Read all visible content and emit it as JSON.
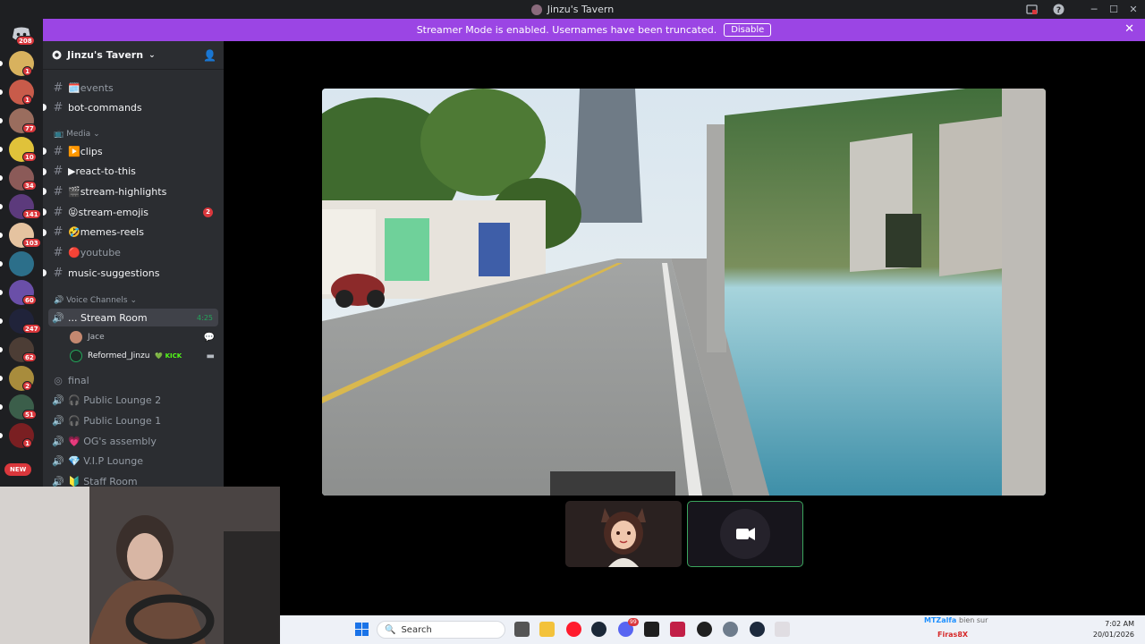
{
  "window": {
    "title": "Jinzu's Tavern"
  },
  "banner": {
    "text": "Streamer Mode is enabled. Usernames have been truncated.",
    "button": "Disable"
  },
  "rail": {
    "home_badge": "208",
    "servers": [
      {
        "badge": "1",
        "color": "#d8b25e"
      },
      {
        "badge": "1",
        "color": "#c85b4a"
      },
      {
        "badge": "77",
        "color": "#9a6d5e"
      },
      {
        "badge": "10",
        "color": "#e0c23a"
      },
      {
        "badge": "34",
        "color": "#8b5a58"
      },
      {
        "badge": "141",
        "color": "#5c3a7c"
      },
      {
        "badge": "103",
        "color": "#e5c3a0"
      },
      {
        "badge": "",
        "color": "#2c6f8a"
      },
      {
        "badge": "60",
        "color": "#6a4fa8"
      },
      {
        "badge": "247",
        "color": "#20233a"
      },
      {
        "badge": "62",
        "color": "#4c3d35"
      },
      {
        "badge": "2",
        "color": "#a88c3c"
      },
      {
        "badge": "51",
        "color": "#3b5e4a"
      },
      {
        "badge": "1",
        "color": "#7a1f22"
      }
    ],
    "new_label": "NEW"
  },
  "sidebar": {
    "server_name": "Jinzu's Tavern",
    "channels_top": [
      {
        "name": "🗓️events",
        "unread": false
      },
      {
        "name": "bot-commands",
        "unread": true
      }
    ],
    "media_category": "📺 Media",
    "media_channels": [
      {
        "name": "▶️clips",
        "unread": true,
        "badge": ""
      },
      {
        "name": "▶react-to-this",
        "unread": true,
        "badge": ""
      },
      {
        "name": "🎬stream-highlights",
        "unread": true,
        "badge": ""
      },
      {
        "name": "😝stream-emojis",
        "unread": true,
        "badge": "2"
      },
      {
        "name": "🤣memes-reels",
        "unread": true,
        "badge": ""
      },
      {
        "name": "🔴youtube",
        "unread": false,
        "badge": ""
      },
      {
        "name": "music-suggestions",
        "unread": true,
        "badge": ""
      }
    ],
    "voice_category": "🔊 Voice Channels",
    "active_voice": {
      "name": "... Stream Room",
      "time": "4:25"
    },
    "voice_users": [
      {
        "name": "Jace",
        "tag": ""
      },
      {
        "name": "Reformed_Jinzu",
        "tag": "💚 KICK"
      }
    ],
    "other_voice": [
      {
        "name": "final",
        "stage": true
      },
      {
        "name": "🎧 Public Lounge 2",
        "stage": false
      },
      {
        "name": "🎧 Public Lounge 1",
        "stage": false
      },
      {
        "name": "💗 OG's assembly",
        "stage": false
      },
      {
        "name": "💎 V.I.P Lounge",
        "stage": false
      },
      {
        "name": "🔰 Staff Room",
        "stage": false
      }
    ]
  },
  "taskbar": {
    "search_placeholder": "Search",
    "chat": [
      {
        "user": "MTZalfa",
        "msg": "bien sur"
      },
      {
        "user": "Firas8X",
        "msg": ""
      }
    ],
    "time": "7:02 AM",
    "date": "20/01/2026",
    "discord_badge": "99"
  }
}
